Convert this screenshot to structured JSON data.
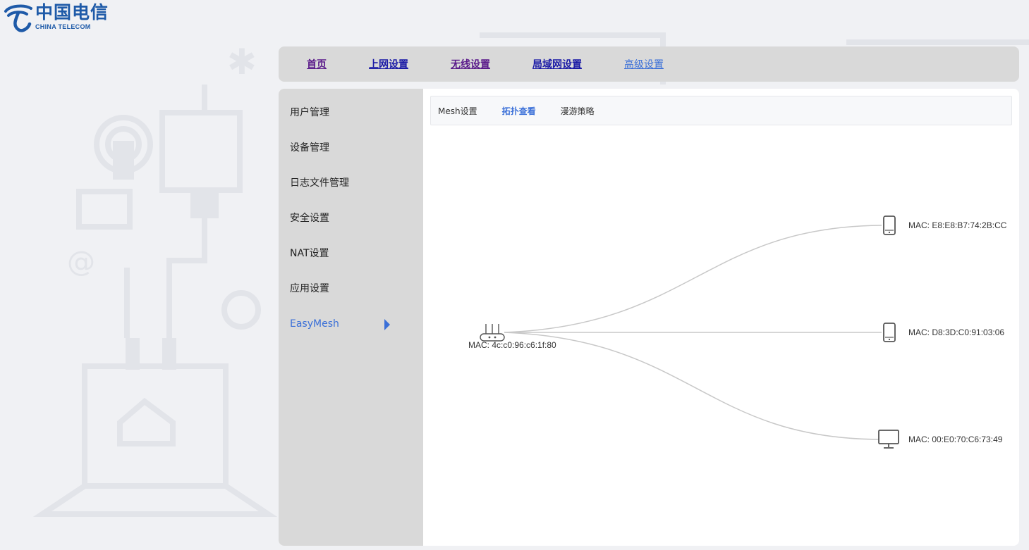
{
  "brand": {
    "name_cn": "中国电信",
    "name_en": "CHINA TELECOM",
    "color": "#1e5aa8"
  },
  "topnav": {
    "items": [
      {
        "label": "首页",
        "state": "visited"
      },
      {
        "label": "上网设置",
        "state": "normal"
      },
      {
        "label": "无线设置",
        "state": "visited"
      },
      {
        "label": "局域网设置",
        "state": "normal"
      },
      {
        "label": "高级设置",
        "state": "active"
      }
    ]
  },
  "sidebar": {
    "items": [
      {
        "label": "用户管理"
      },
      {
        "label": "设备管理"
      },
      {
        "label": "日志文件管理"
      },
      {
        "label": "安全设置"
      },
      {
        "label": "NAT设置"
      },
      {
        "label": "应用设置"
      },
      {
        "label": "EasyMesh",
        "active": true
      }
    ]
  },
  "tabs": [
    {
      "label": "Mesh设置"
    },
    {
      "label": "拓扑查看",
      "active": true
    },
    {
      "label": "漫游策略"
    }
  ],
  "topology": {
    "root": {
      "icon": "router-icon",
      "mac": "MAC: 4c:c0:96:c6:1f:80"
    },
    "children": [
      {
        "icon": "phone-icon",
        "mac": "MAC: E8:E8:B7:74:2B:CC"
      },
      {
        "icon": "phone-icon",
        "mac": "MAC: D8:3D:C0:91:03:06"
      },
      {
        "icon": "monitor-icon",
        "mac": "MAC: 00:E0:70:C6:73:49"
      }
    ]
  },
  "colors": {
    "accent": "#3a6fd8",
    "link": "#1a1aa6",
    "visited_link": "#5a1a8a",
    "panel_gray": "#d9d9d9",
    "edge": "#c8c8c8"
  }
}
